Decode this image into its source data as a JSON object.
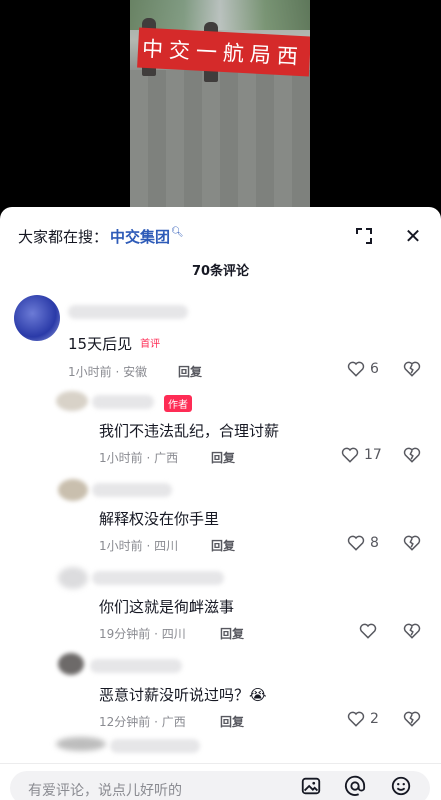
{
  "video": {
    "banner_text": "中交一航局西"
  },
  "sheet": {
    "search_prefix": "大家都在搜：",
    "search_keyword": "中交集团",
    "comment_count": "70条评论"
  },
  "comments": [
    {
      "text": "15天后见",
      "badge": "首评",
      "time": "1小时前 · 安徽",
      "reply": "回复",
      "likes": "6"
    },
    {
      "text": "我们不违法乱纪，合理讨薪",
      "badge": "作者",
      "time": "1小时前 · 广西",
      "reply": "回复",
      "likes": "17"
    },
    {
      "text": "解释权没在你手里",
      "time": "1小时前 · 四川",
      "reply": "回复",
      "likes": "8"
    },
    {
      "text": "你们这就是徇衅滋事",
      "time": "19分钟前 · 四川",
      "reply": "回复",
      "likes": ""
    },
    {
      "text": "恶意讨薪没听说过吗？😭",
      "time": "12分钟前 · 广西",
      "reply": "回复",
      "likes": "2"
    }
  ],
  "input": {
    "placeholder": "有爱评论，说点儿好听的"
  },
  "colors": {
    "accent": "#fe2c55",
    "link": "#2e5bb8"
  }
}
